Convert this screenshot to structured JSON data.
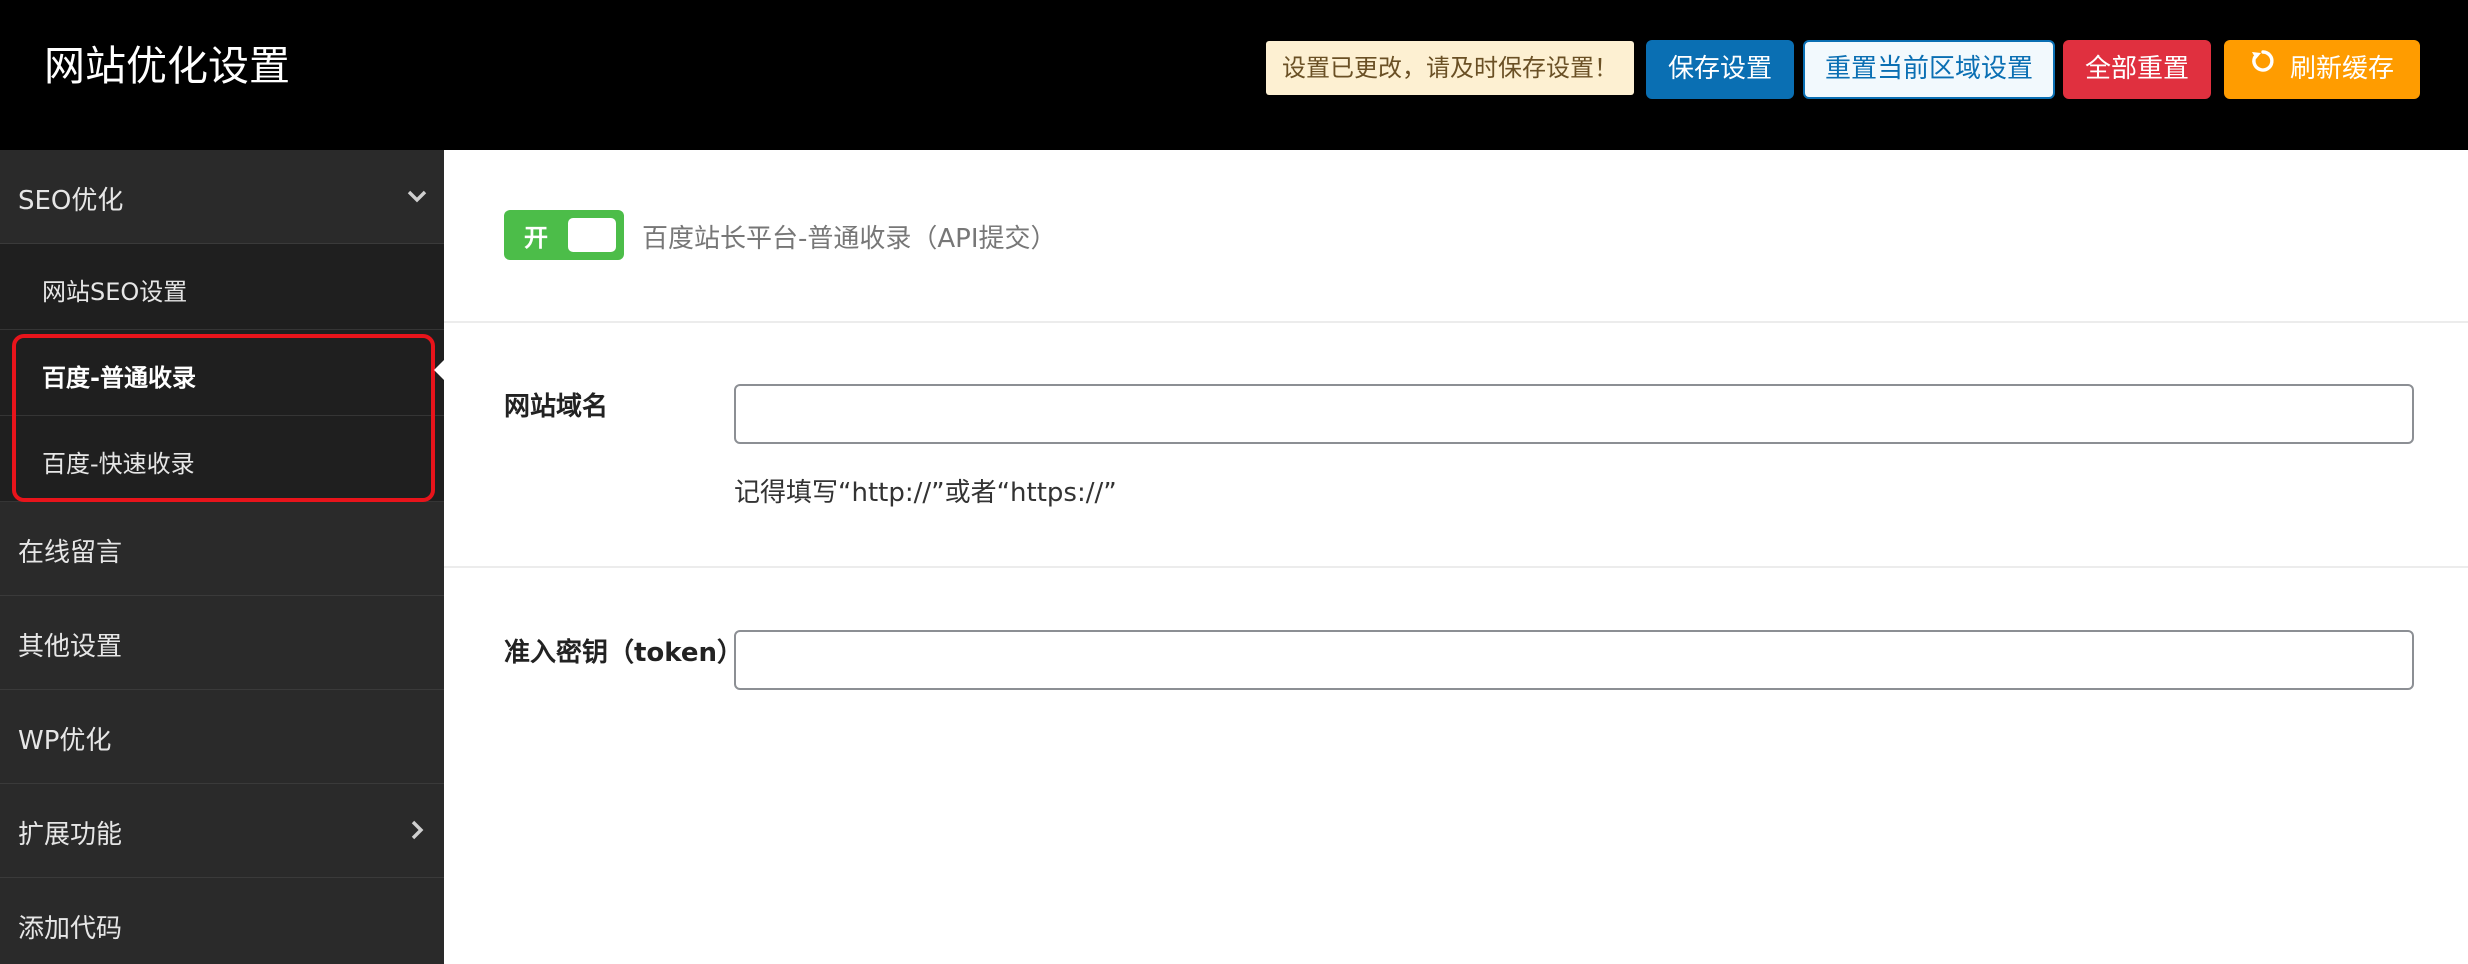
{
  "header": {
    "title": "网站优化设置",
    "notice": "设置已更改，请及时保存设置！",
    "save_label": "保存设置",
    "reset_area_label": "重置当前区域设置",
    "reset_all_label": "全部重置",
    "refresh_label": "刷新缓存",
    "refresh_icon": "refresh-icon"
  },
  "sidebar": {
    "items": [
      {
        "label": "SEO优化",
        "icon": "chevron-down-icon"
      },
      {
        "label": "网站SEO设置"
      },
      {
        "label": "百度-普通收录"
      },
      {
        "label": "百度-快速收录"
      },
      {
        "label": "在线留言"
      },
      {
        "label": "其他设置"
      },
      {
        "label": "WP优化"
      },
      {
        "label": "扩展功能",
        "icon": "chevron-right-icon"
      },
      {
        "label": "添加代码"
      }
    ]
  },
  "main": {
    "toggle": {
      "text": "开",
      "state": "on",
      "color": "#4cbd49"
    },
    "toggle_label": "百度站长平台-普通收录（API提交）",
    "fields": [
      {
        "label": "网站域名",
        "value": "",
        "hint": "记得填写“http://”或者“https://”"
      },
      {
        "label": "准入密钥（token）",
        "value": ""
      }
    ]
  },
  "colors": {
    "header_bg": "#000000",
    "sidebar_bg": "#2a2a2a",
    "save_button": "#0a6fb3",
    "reset_all_button": "#e0303f",
    "refresh_button": "#ff9c00",
    "highlight_border": "#e8141b"
  }
}
